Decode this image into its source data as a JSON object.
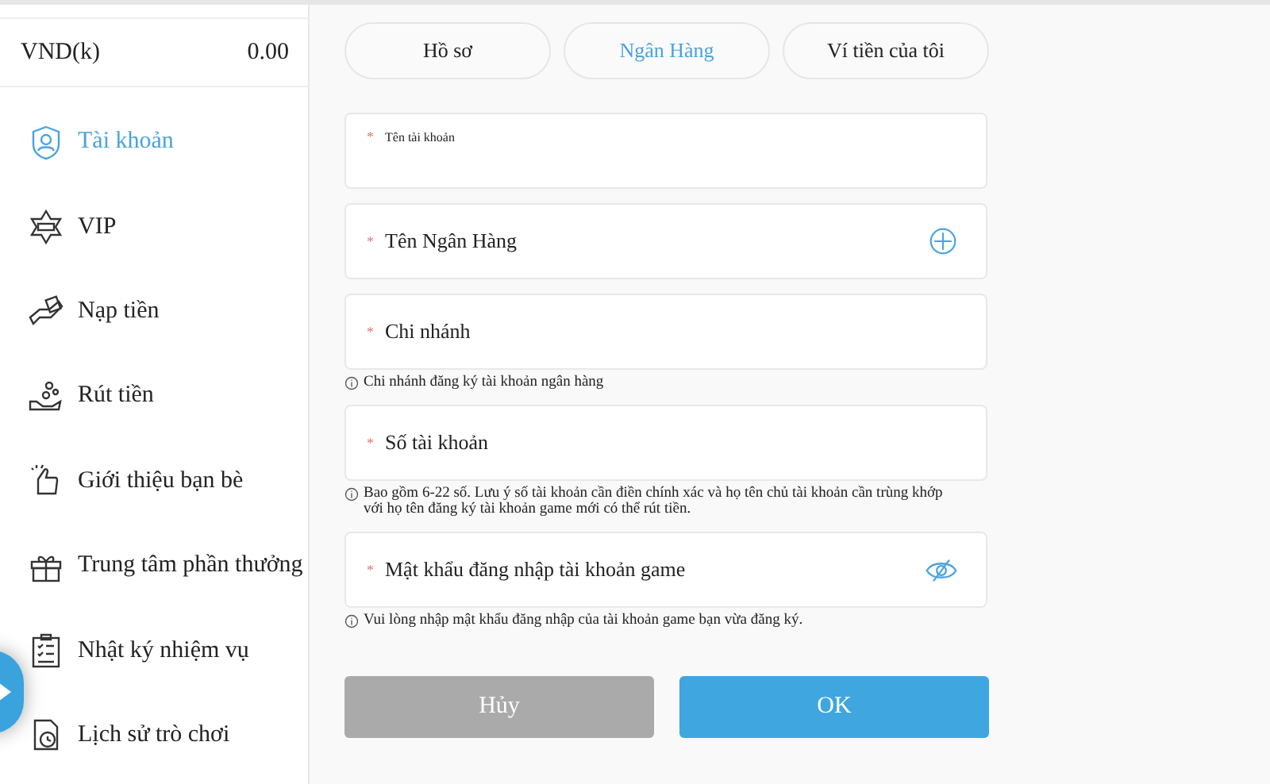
{
  "balance": {
    "currency": "VND(k)",
    "amount": "0.00"
  },
  "menu": [
    {
      "label": "Tài khoản",
      "selected": true
    },
    {
      "label": "VIP",
      "selected": false
    },
    {
      "label": "Nạp tiền",
      "selected": false
    },
    {
      "label": "Rút tiền",
      "selected": false
    },
    {
      "label": "Giới thiệu bạn bè",
      "selected": false
    },
    {
      "label": "Trung tâm phần thưởng",
      "selected": false
    },
    {
      "label": "Nhật ký nhiệm vụ",
      "selected": false
    },
    {
      "label": "Lịch sử trò chơi",
      "selected": false
    }
  ],
  "tabs": [
    {
      "label": "Hồ sơ",
      "selected": false
    },
    {
      "label": "Ngân Hàng",
      "selected": true
    },
    {
      "label": "Ví tiền của tôi",
      "selected": false
    }
  ],
  "fields": [
    {
      "kind": "floating",
      "label": "Tên tài khoản",
      "required_mark": "*"
    },
    {
      "kind": "select",
      "label": "Tên Ngân Hàng",
      "required_mark": "*"
    },
    {
      "kind": "text",
      "label": "Chi nhánh",
      "required_mark": "*",
      "hint": "Chi nhánh đăng ký tài khoản ngân hàng"
    },
    {
      "kind": "text",
      "label": "Số tài khoản",
      "required_mark": "*",
      "hint": "Bao gồm 6-22 số. Lưu ý số tài khoản cần điền chính xác và họ tên chủ tài khoản cần trùng khớp với họ tên đăng ký tài khoản game mới có thể rút tiền."
    },
    {
      "kind": "password",
      "label": "Mật khẩu đăng nhập tài khoản game",
      "required_mark": "*",
      "hint": "Vui lòng nhập mật khẩu đăng nhập của tài khoản game bạn vừa đăng ký."
    }
  ],
  "buttons": [
    {
      "label": "Hủy",
      "kind": "cancel"
    },
    {
      "label": "OK",
      "kind": "primary"
    }
  ]
}
